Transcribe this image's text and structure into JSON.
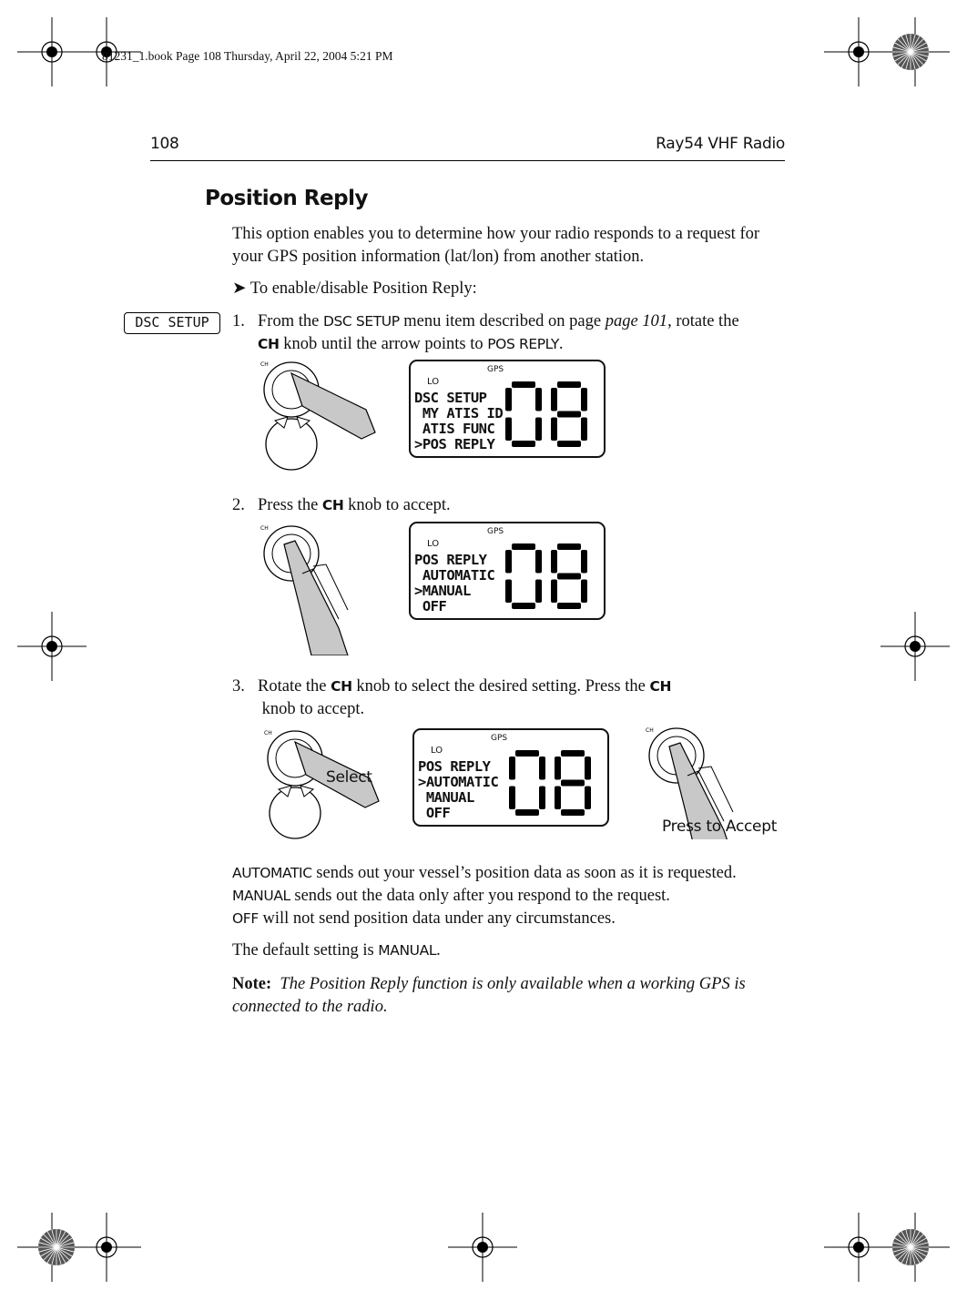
{
  "slug": "81231_1.book  Page 108  Thursday, April 22, 2004  5:21 PM",
  "header": {
    "page_number": "108",
    "book_title": "Ray54 VHF Radio"
  },
  "section_title": "Position Reply",
  "intro": "This option enables you to determine how your radio responds to a request for your GPS position information (lat/lon) from another station.",
  "procedure": {
    "arrow": "➤",
    "label": "To enable/disable Position Reply:"
  },
  "margin_tag": "DSC SETUP",
  "steps": [
    {
      "num": "1.",
      "t1": "From the ",
      "k1": "DSC SETUP",
      "t2": " menu item described on page ",
      "ref": "page 101",
      "t3": ", rotate the ",
      "k2": "CH",
      "t4": " knob until the arrow points to ",
      "k3": "POS REPLY",
      "t5": "."
    },
    {
      "num": "2.",
      "t1": "Press the ",
      "k1": "CH",
      "t2": " knob to accept."
    },
    {
      "num": "3.",
      "t1": "Rotate the ",
      "k1": "CH",
      "t2": " knob to select the desired setting. Press the ",
      "k2": "CH",
      "t3": " knob to accept."
    }
  ],
  "displays": [
    {
      "gps": "GPS",
      "lo": "LO",
      "lines": "DSC SETUP\n MY ATIS ID\n ATIS FUNC\n>POS REPLY",
      "channel": "08"
    },
    {
      "gps": "GPS",
      "lo": "LO",
      "lines": "POS REPLY\n AUTOMATIC\n>MANUAL\n OFF",
      "channel": "08"
    },
    {
      "gps": "GPS",
      "lo": "LO",
      "lines": "POS REPLY\n>AUTOMATIC\n MANUAL\n OFF",
      "channel": "08"
    }
  ],
  "knob_label": "CH",
  "captions": {
    "select": "Select",
    "press": "Press to Accept"
  },
  "options": [
    {
      "key": "AUTOMATIC",
      "text": " sends out your vessel’s position data as soon as it is requested."
    },
    {
      "key": "MANUAL",
      "text": " sends out the data only after you respond to the request."
    },
    {
      "key": "OFF",
      "text": " will not send position data under any circumstances."
    }
  ],
  "default": {
    "text": "The default setting is ",
    "key": "MANUAL",
    "end": "."
  },
  "note": {
    "label": "Note:",
    "text": "The Position Reply function is only available when a working GPS is connected to the radio."
  }
}
